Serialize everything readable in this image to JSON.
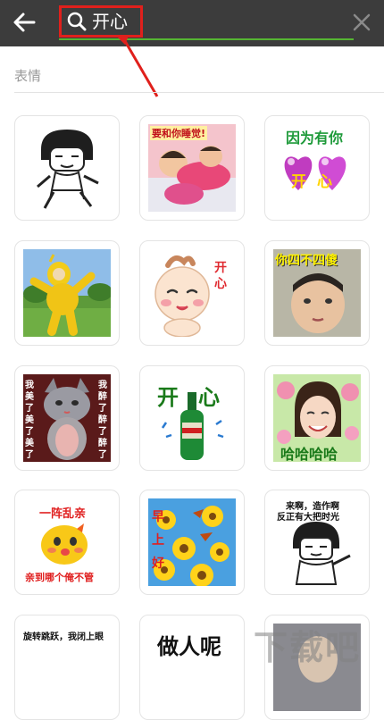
{
  "header": {
    "search_value": "开心"
  },
  "section": {
    "title": "表情"
  },
  "stickers": [
    {
      "name": "mushroom-head-dancing",
      "caption": ""
    },
    {
      "name": "sleeping-kids",
      "caption": "要和你睡觉!"
    },
    {
      "name": "hearts-happy",
      "caption_top": "因为有你",
      "caption_bottom": "开心"
    },
    {
      "name": "teletubby",
      "caption": ""
    },
    {
      "name": "cartoon-baby",
      "caption": "开心"
    },
    {
      "name": "boy-face",
      "caption": "你四不四傻"
    },
    {
      "name": "cat-drunk",
      "left_text": "我美了美了美了",
      "right_text": "我醉了醉了醉了"
    },
    {
      "name": "beer-happy",
      "caption": "开心"
    },
    {
      "name": "girl-laugh",
      "caption": "哈哈哈哈"
    },
    {
      "name": "yellow-blob",
      "caption_top": "一阵乱亲",
      "caption_bottom": "亲到哪个俺不管"
    },
    {
      "name": "sunflowers",
      "caption": "早上好"
    },
    {
      "name": "mushroom-head-meme",
      "caption_top": "来啊，造作啊",
      "caption_bottom": "反正有大把时光"
    },
    {
      "name": "spin-jump",
      "caption": "旋转跳跃，我闭上眼"
    },
    {
      "name": "be-a-person",
      "caption": "做人呢"
    },
    {
      "name": "partial-photo",
      "caption": ""
    }
  ],
  "watermark": "下载吧"
}
